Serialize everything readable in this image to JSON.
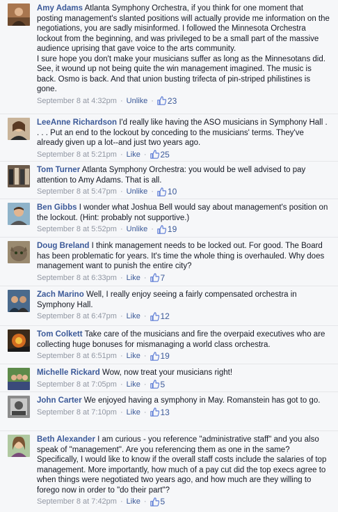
{
  "thumb_color": "#5b7bd5",
  "comments": [
    {
      "author": "Amy Adams",
      "text": "Atlanta Symphony Orchestra, if you think for one moment that posting management's slanted positions will actually provide me information on the negotiations, you are sadly misinformed. I followed the Minnesota Orchestra lockout from the beginning, and was privileged to be a small part of the massive audience uprising that gave voice to the arts community.\nI sure hope you don't make your musicians suffer as long as the Minnesotans did. See, it wound up not being quite the win management imagined. The music is back. Osmo is back. And that union busting trifecta of pin-striped philistines is gone.",
      "timestamp": "September 8 at 4:32pm",
      "action": "Unlike",
      "likes": "23",
      "avatar_icon": "avatar-photo-icon"
    },
    {
      "author": "LeeAnne Richardson",
      "text": "I'd really like having the ASO musicians in Symphony Hall . . . . Put an end to the lockout by conceding to the musicians' terms. They've already given up a lot--and just two years ago.",
      "timestamp": "September 8 at 5:21pm",
      "action": "Like",
      "likes": "25",
      "avatar_icon": "avatar-photo-icon"
    },
    {
      "author": "Tom Turner",
      "text": "Atlanta Symphony Orchestra: you would be well advised to pay attention to Amy Adams. That is all.",
      "timestamp": "September 8 at 5:47pm",
      "action": "Unlike",
      "likes": "10",
      "avatar_icon": "avatar-photo-icon"
    },
    {
      "author": "Ben Gibbs",
      "text": "I wonder what Joshua Bell would say about management's position on the lockout. (Hint: probably not supportive.)",
      "timestamp": "September 8 at 5:52pm",
      "action": "Unlike",
      "likes": "19",
      "avatar_icon": "avatar-photo-icon"
    },
    {
      "author": "Doug Breland",
      "text": "I think management needs to be locked out. For good. The Board has been problematic for years. It's time the whole thing is overhauled. Why does management want to punish the entire city?",
      "timestamp": "September 8 at 6:33pm",
      "action": "Like",
      "likes": "7",
      "avatar_icon": "avatar-photo-icon"
    },
    {
      "author": "Zach Marino",
      "text": "Well, I really enjoy seeing a fairly compensated orchestra in Symphony Hall.",
      "timestamp": "September 8 at 6:47pm",
      "action": "Like",
      "likes": "12",
      "avatar_icon": "avatar-photo-icon"
    },
    {
      "author": "Tom Colkett",
      "text": "Take care of the musicians and fire the overpaid executives who are collecting huge bonuses for mismanaging a world class orchestra.",
      "timestamp": "September 8 at 6:51pm",
      "action": "Like",
      "likes": "19",
      "avatar_icon": "avatar-photo-icon"
    },
    {
      "author": "Michelle Rickard",
      "text": "Wow, now treat your musicians right!",
      "timestamp": "September 8 at 7:05pm",
      "action": "Like",
      "likes": "5",
      "avatar_icon": "avatar-photo-icon"
    },
    {
      "author": "John Carter",
      "text": "We enjoyed having a symphony in May. Romanstein has got to go.",
      "timestamp": "September 8 at 7:10pm",
      "action": "Like",
      "likes": "13",
      "avatar_icon": "avatar-photo-icon"
    },
    {
      "author": "Beth Alexander",
      "text": "I am curious - you reference \"administrative staff\" and you also speak of \"management\". Are you referencing them as one in the same? Specifically, I would like to know if the overall staff costs include the salaries of top management. More importantly, how much of a pay cut did the top execs agree to when things were negotiated two years ago, and how much are they willing to forego now in order to \"do their part\"?",
      "timestamp": "September 8 at 7:42pm",
      "action": "Like",
      "likes": "5",
      "avatar_icon": "avatar-photo-icon"
    }
  ]
}
